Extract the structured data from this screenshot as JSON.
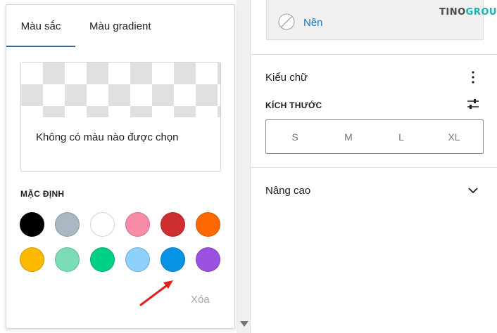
{
  "popover": {
    "tabs": [
      {
        "label": "Màu sắc"
      },
      {
        "label": "Màu gradient"
      }
    ],
    "preview_text": "Không có màu nào được chọn",
    "section_label": "MẶC ĐỊNH",
    "palette": [
      {
        "color": "#000000"
      },
      {
        "color": "#abb8c3"
      },
      {
        "color": "#ffffff"
      },
      {
        "color": "#f78da7"
      },
      {
        "color": "#cf2e2e"
      },
      {
        "color": "#ff6900"
      },
      {
        "color": "#fcb900"
      },
      {
        "color": "#7bdcb5"
      },
      {
        "color": "#00d084"
      },
      {
        "color": "#8ed1fc"
      },
      {
        "color": "#0693e3"
      },
      {
        "color": "#9b51e0"
      }
    ],
    "clear_label": "Xóa"
  },
  "sidebar": {
    "background_label": "Nền",
    "logo": {
      "part1": "TINO",
      "part2": "GROUP"
    },
    "typography_title": "Kiểu chữ",
    "size_label": "KÍCH THƯỚC",
    "size_options": [
      "S",
      "M",
      "L",
      "XL"
    ],
    "advanced_title": "Nâng cao"
  },
  "colors": {
    "tab_accent": "#2f6f9f",
    "link": "#2271b1",
    "annotation_arrow": "#e02020"
  },
  "icons": {
    "background": "no-color-icon",
    "typography_menu": "more-vertical-icon",
    "size_settings": "settings-sliders-icon",
    "advanced_toggle": "chevron-down-icon",
    "scroll": "triangle-down-icon"
  }
}
